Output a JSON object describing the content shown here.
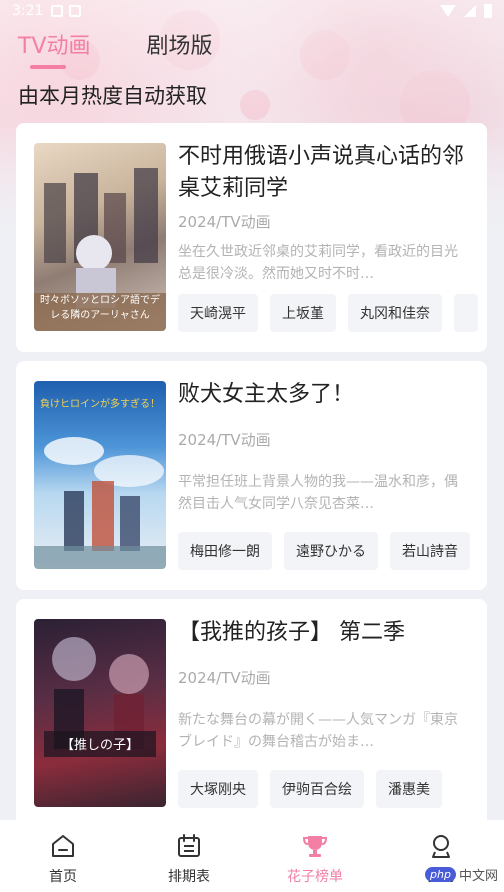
{
  "status_bar": {
    "time": "3:21"
  },
  "tabs": [
    {
      "label": "TV动画",
      "active": true
    },
    {
      "label": "剧场版",
      "active": false
    }
  ],
  "subtitle": "由本月热度自动获取",
  "cards": [
    {
      "title": "不时用俄语小声说真心话的邻桌艾莉同学",
      "meta": "2024/TV动画",
      "desc": "坐在久世政近邻桌的艾莉同学，看政近的目光总是很冷淡。然而她又时不时…",
      "cover_label": "时々ボソッとロシア語でデレる隣のアーリャさん",
      "cast": [
        "天崎滉平",
        "上坂堇",
        "丸冈和佳奈",
        ""
      ]
    },
    {
      "title": "败犬女主太多了！",
      "meta": "2024/TV动画",
      "desc": "平常担任班上背景人物的我——温水和彦，偶然目击人气女同学八奈见杏菜…",
      "cover_label": "負けヒロインが多すぎる！",
      "cast": [
        "梅田修一朗",
        "遠野ひかる",
        "若山詩音"
      ]
    },
    {
      "title": "【我推的孩子】 第二季",
      "meta": "2024/TV动画",
      "desc": "新たな舞台の幕が開く——人気マンガ『東京ブレイド』の舞台稽古が始ま…",
      "cover_label": "【推しの子】",
      "cast": [
        "大塚刚央",
        "伊驹百合绘",
        "潘惠美"
      ]
    }
  ],
  "bottom_nav": [
    {
      "label": "首页",
      "icon": "home-icon",
      "active": false
    },
    {
      "label": "排期表",
      "icon": "calendar-icon",
      "active": false
    },
    {
      "label": "花子榜单",
      "icon": "trophy-icon",
      "active": true
    },
    {
      "label": "我的",
      "icon": "profile-icon",
      "active": false
    }
  ],
  "watermark": {
    "logo": "php",
    "text": "中文网"
  },
  "colors": {
    "accent": "#f47fa4",
    "background": "#eef0f5",
    "muted_text": "#aaaaaa"
  }
}
